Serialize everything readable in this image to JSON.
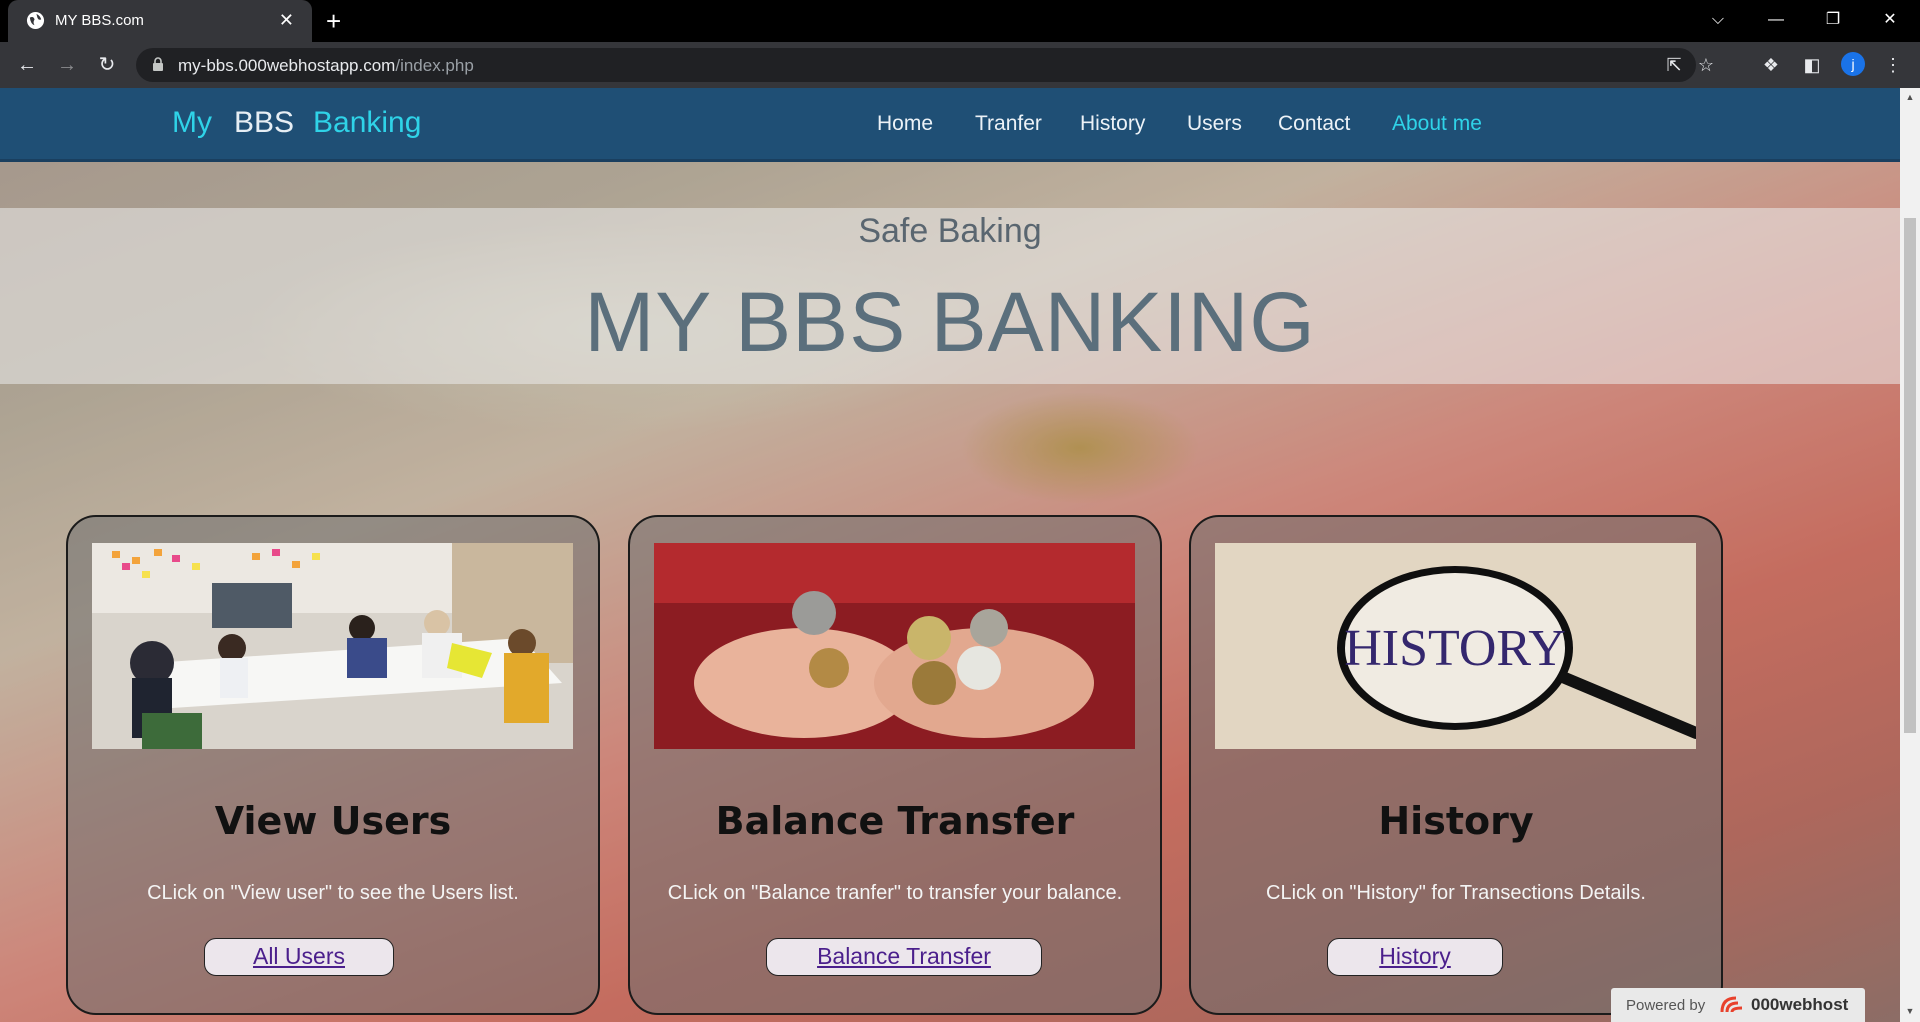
{
  "browser": {
    "tab_title": "MY BBS.com",
    "tab_close": "✕",
    "new_tab": "+",
    "url_host": "my-bbs.000webhostapp.com",
    "url_path": "/index.php",
    "profile_initial": "j",
    "window_controls": {
      "dropdown": "⌵",
      "minimize": "—",
      "restore": "❐",
      "close": "✕"
    }
  },
  "site": {
    "brand": {
      "part1": "My",
      "part2": "BBS",
      "part3": "Banking"
    },
    "nav": [
      "Home",
      "Tranfer",
      "History",
      "Users",
      "Contact",
      "About me"
    ],
    "hero": {
      "subtitle": "Safe Baking",
      "title": "MY BBS BANKING"
    },
    "cards": [
      {
        "title": "View Users",
        "text": "CLick on \"View user\" to see the Users list.",
        "button": "All Users"
      },
      {
        "title": "Balance Transfer",
        "text": "CLick on \"Balance tranfer\" to transfer your balance.",
        "button": "Balance Transfer"
      },
      {
        "title": "History",
        "text": "CLick on \"History\" for Transections Details.",
        "button": "History"
      }
    ],
    "history_image_text": "HISTORY",
    "powered": {
      "label": "Powered by",
      "brand": "000webhost"
    }
  },
  "colors": {
    "nav_bg": "#1f4f75",
    "accent_cyan": "#2fd3e8",
    "link_purple": "#4b1f8c"
  }
}
